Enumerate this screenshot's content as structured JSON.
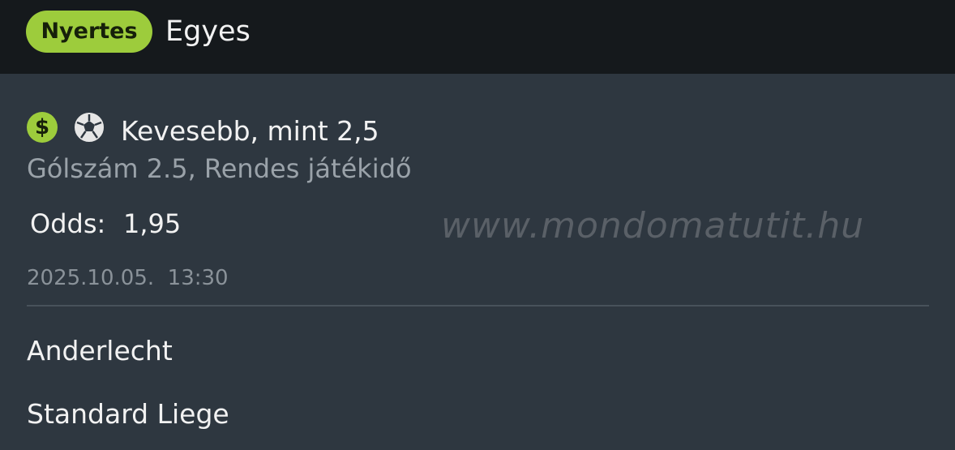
{
  "header": {
    "status_badge": "Nyertes",
    "bet_type": "Egyes"
  },
  "bet": {
    "icons": [
      "dollar-icon",
      "soccer-ball-icon"
    ],
    "selection": "Kevesebb, mint 2,5",
    "market": "Gólszám 2.5, Rendes játékidő",
    "odds_label": "Odds:",
    "odds_value": "1,95",
    "timestamp": "2025.10.05.  13:30"
  },
  "watermark": "www.mondomatutit.hu",
  "teams": {
    "home": "Anderlecht",
    "away": "Standard Liege"
  },
  "colors": {
    "accent": "#9dcc3c",
    "header_bg": "#15191c",
    "body_bg": "#2e3740"
  }
}
